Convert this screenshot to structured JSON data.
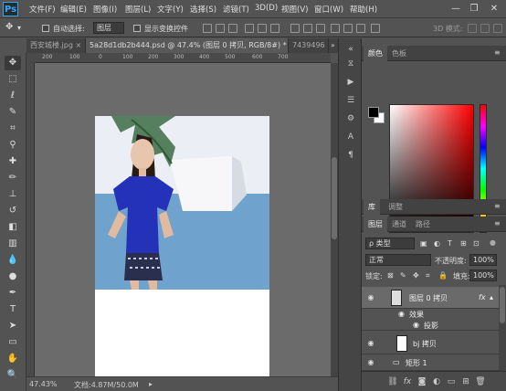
{
  "app": {
    "logo": "Ps",
    "menu": [
      "文件(F)",
      "编辑(E)",
      "图像(I)",
      "图层(L)",
      "文字(Y)",
      "选择(S)",
      "滤镜(T)",
      "3D(D)",
      "视图(V)",
      "窗口(W)",
      "帮助(H)"
    ],
    "window_buttons": {
      "minimize": "—",
      "restore": "❐",
      "close": "✕"
    }
  },
  "options": {
    "auto_select_label": "自动选择:",
    "auto_select_value": "图层",
    "show_transform_label": "显示变换控件",
    "mode_label": "3D 模式:"
  },
  "tabs": [
    {
      "label": "西安城楼.jpg",
      "active": false
    },
    {
      "label": "5a28d1db2b444.psd @ 47.4% (图层 0 拷贝, RGB/8#) *",
      "active": true
    },
    {
      "label": "7439496",
      "active": false
    }
  ],
  "ruler": {
    "top_labels": [
      "200",
      "100",
      "0",
      "100",
      "200",
      "300",
      "400",
      "500",
      "600",
      "700"
    ]
  },
  "status": {
    "zoom": "47.43%",
    "doc": "文档:4.87M/50.0M"
  },
  "right_panel": {
    "color_tabs": [
      "颜色",
      "色板"
    ],
    "lib_tabs": [
      "库",
      "调整"
    ],
    "layer_tabs": [
      "图层",
      "通道",
      "路径"
    ],
    "filter_label": "ρ 类型",
    "blend_mode": "正常",
    "opacity_label": "不透明度:",
    "opacity_value": "100%",
    "lock_label": "锁定:",
    "fill_label": "填充:",
    "fill_value": "100%",
    "layers": [
      {
        "name": "图层 0 拷贝",
        "fx": "fx",
        "selected": true
      },
      {
        "name": "效果",
        "sub": true
      },
      {
        "name": "投影",
        "sub": true
      },
      {
        "name": "bj 拷贝",
        "selected": false
      },
      {
        "name": "矩形 1",
        "selected": false
      }
    ]
  },
  "colors": {
    "accent": "#31a8ff",
    "photo_sky": "#6fa2cc",
    "shirt": "#2332b8"
  }
}
